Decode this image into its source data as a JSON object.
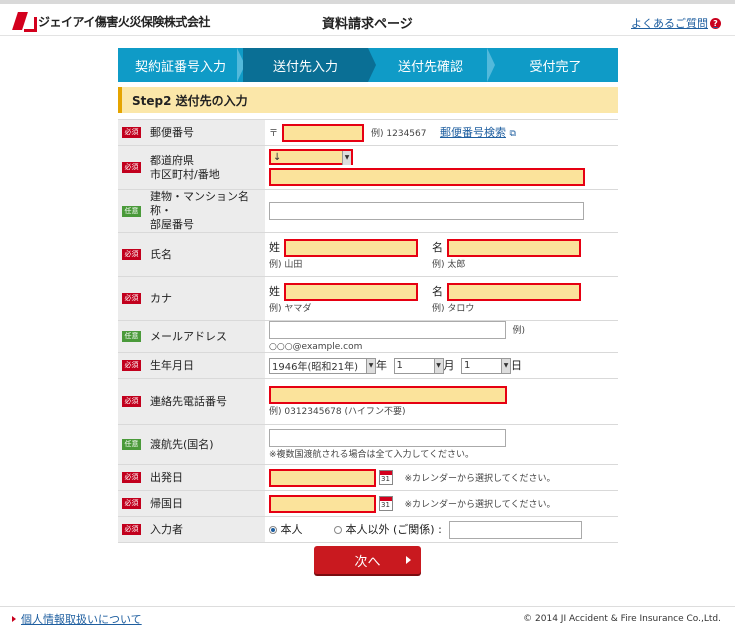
{
  "header": {
    "company": "ジェイアイ傷害火災保険株式会社",
    "page_title": "資料請求ページ",
    "faq_label": "よくあるご質問",
    "faq_icon_text": "?"
  },
  "steps": [
    "契約証番号入力",
    "送付先入力",
    "送付先確認",
    "受付完了"
  ],
  "section_title": "Step2 送付先の入力",
  "badges": {
    "required": "必須",
    "optional": "任意"
  },
  "form": {
    "postal": {
      "label": "郵便番号",
      "prefix": "〒",
      "example": "例) 1234567",
      "search_link": "郵便番号検索"
    },
    "address": {
      "label_line1": "都道府県",
      "label_line2": "市区町村/番地",
      "select_value": "↓"
    },
    "building": {
      "label_line1": "建物・マンション名称・",
      "label_line2": "部屋番号"
    },
    "name": {
      "label": "氏名",
      "sei": "姓",
      "mei": "名",
      "sei_example": "例) 山田",
      "mei_example": "例) 太郎"
    },
    "kana": {
      "label": "カナ",
      "sei": "姓",
      "mei": "名",
      "sei_example": "例) ヤマダ",
      "mei_example": "例) タロウ"
    },
    "email": {
      "label": "メールアドレス",
      "example": "例) ○○○@example.com"
    },
    "birth": {
      "label": "生年月日",
      "year_value": "1946年(昭和21年)",
      "year_unit": "年",
      "month_value": "1",
      "month_unit": "月",
      "day_value": "1",
      "day_unit": "日"
    },
    "phone": {
      "label": "連絡先電話番号",
      "example": "例) 0312345678 (ハイフン不要)"
    },
    "destination": {
      "label": "渡航先(国名)",
      "note": "※複数国渡航される場合は全て入力してください。"
    },
    "departure": {
      "label": "出発日",
      "note": "※カレンダーから選択してください。"
    },
    "return": {
      "label": "帰国日",
      "note": "※カレンダーから選択してください。"
    },
    "inputter": {
      "label": "入力者",
      "option_self": "本人",
      "option_other": "本人以外 (ご関係) :"
    }
  },
  "calendar_icon_text": "31",
  "next_button": "次へ",
  "footer": {
    "privacy_link": "個人情報取扱いについて",
    "copyright": "© 2014 JI Accident & Fire Insurance Co.,Ltd."
  }
}
